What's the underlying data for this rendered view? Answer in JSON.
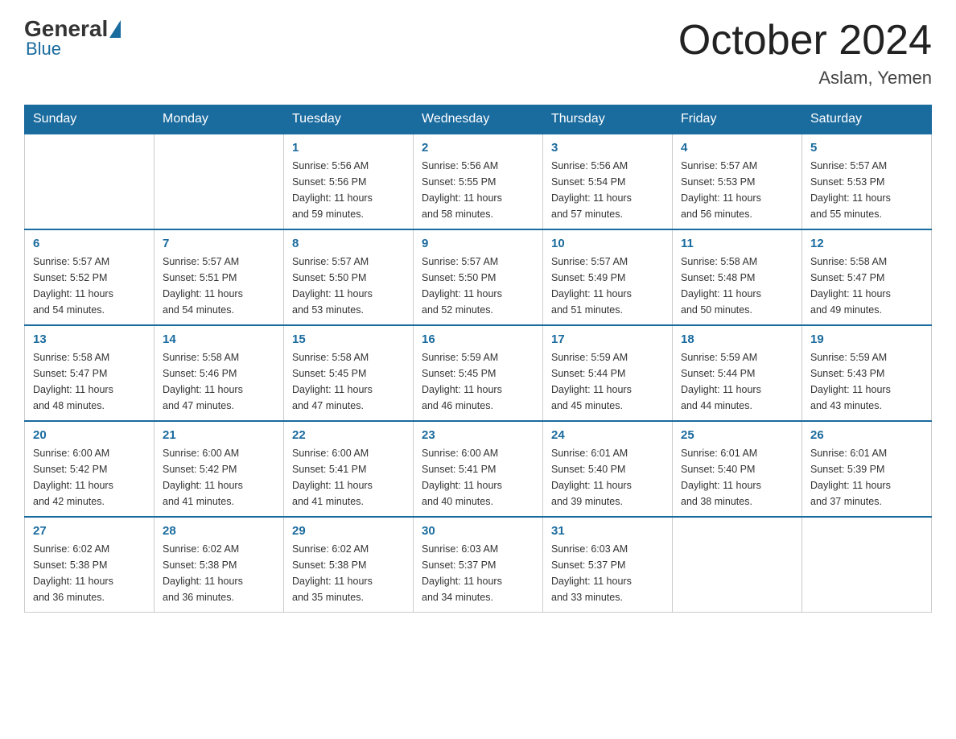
{
  "logo": {
    "general": "General",
    "blue": "Blue"
  },
  "title": "October 2024",
  "location": "Aslam, Yemen",
  "days_of_week": [
    "Sunday",
    "Monday",
    "Tuesday",
    "Wednesday",
    "Thursday",
    "Friday",
    "Saturday"
  ],
  "weeks": [
    [
      {
        "day": "",
        "info": ""
      },
      {
        "day": "",
        "info": ""
      },
      {
        "day": "1",
        "info": "Sunrise: 5:56 AM\nSunset: 5:56 PM\nDaylight: 11 hours\nand 59 minutes."
      },
      {
        "day": "2",
        "info": "Sunrise: 5:56 AM\nSunset: 5:55 PM\nDaylight: 11 hours\nand 58 minutes."
      },
      {
        "day": "3",
        "info": "Sunrise: 5:56 AM\nSunset: 5:54 PM\nDaylight: 11 hours\nand 57 minutes."
      },
      {
        "day": "4",
        "info": "Sunrise: 5:57 AM\nSunset: 5:53 PM\nDaylight: 11 hours\nand 56 minutes."
      },
      {
        "day": "5",
        "info": "Sunrise: 5:57 AM\nSunset: 5:53 PM\nDaylight: 11 hours\nand 55 minutes."
      }
    ],
    [
      {
        "day": "6",
        "info": "Sunrise: 5:57 AM\nSunset: 5:52 PM\nDaylight: 11 hours\nand 54 minutes."
      },
      {
        "day": "7",
        "info": "Sunrise: 5:57 AM\nSunset: 5:51 PM\nDaylight: 11 hours\nand 54 minutes."
      },
      {
        "day": "8",
        "info": "Sunrise: 5:57 AM\nSunset: 5:50 PM\nDaylight: 11 hours\nand 53 minutes."
      },
      {
        "day": "9",
        "info": "Sunrise: 5:57 AM\nSunset: 5:50 PM\nDaylight: 11 hours\nand 52 minutes."
      },
      {
        "day": "10",
        "info": "Sunrise: 5:57 AM\nSunset: 5:49 PM\nDaylight: 11 hours\nand 51 minutes."
      },
      {
        "day": "11",
        "info": "Sunrise: 5:58 AM\nSunset: 5:48 PM\nDaylight: 11 hours\nand 50 minutes."
      },
      {
        "day": "12",
        "info": "Sunrise: 5:58 AM\nSunset: 5:47 PM\nDaylight: 11 hours\nand 49 minutes."
      }
    ],
    [
      {
        "day": "13",
        "info": "Sunrise: 5:58 AM\nSunset: 5:47 PM\nDaylight: 11 hours\nand 48 minutes."
      },
      {
        "day": "14",
        "info": "Sunrise: 5:58 AM\nSunset: 5:46 PM\nDaylight: 11 hours\nand 47 minutes."
      },
      {
        "day": "15",
        "info": "Sunrise: 5:58 AM\nSunset: 5:45 PM\nDaylight: 11 hours\nand 47 minutes."
      },
      {
        "day": "16",
        "info": "Sunrise: 5:59 AM\nSunset: 5:45 PM\nDaylight: 11 hours\nand 46 minutes."
      },
      {
        "day": "17",
        "info": "Sunrise: 5:59 AM\nSunset: 5:44 PM\nDaylight: 11 hours\nand 45 minutes."
      },
      {
        "day": "18",
        "info": "Sunrise: 5:59 AM\nSunset: 5:44 PM\nDaylight: 11 hours\nand 44 minutes."
      },
      {
        "day": "19",
        "info": "Sunrise: 5:59 AM\nSunset: 5:43 PM\nDaylight: 11 hours\nand 43 minutes."
      }
    ],
    [
      {
        "day": "20",
        "info": "Sunrise: 6:00 AM\nSunset: 5:42 PM\nDaylight: 11 hours\nand 42 minutes."
      },
      {
        "day": "21",
        "info": "Sunrise: 6:00 AM\nSunset: 5:42 PM\nDaylight: 11 hours\nand 41 minutes."
      },
      {
        "day": "22",
        "info": "Sunrise: 6:00 AM\nSunset: 5:41 PM\nDaylight: 11 hours\nand 41 minutes."
      },
      {
        "day": "23",
        "info": "Sunrise: 6:00 AM\nSunset: 5:41 PM\nDaylight: 11 hours\nand 40 minutes."
      },
      {
        "day": "24",
        "info": "Sunrise: 6:01 AM\nSunset: 5:40 PM\nDaylight: 11 hours\nand 39 minutes."
      },
      {
        "day": "25",
        "info": "Sunrise: 6:01 AM\nSunset: 5:40 PM\nDaylight: 11 hours\nand 38 minutes."
      },
      {
        "day": "26",
        "info": "Sunrise: 6:01 AM\nSunset: 5:39 PM\nDaylight: 11 hours\nand 37 minutes."
      }
    ],
    [
      {
        "day": "27",
        "info": "Sunrise: 6:02 AM\nSunset: 5:38 PM\nDaylight: 11 hours\nand 36 minutes."
      },
      {
        "day": "28",
        "info": "Sunrise: 6:02 AM\nSunset: 5:38 PM\nDaylight: 11 hours\nand 36 minutes."
      },
      {
        "day": "29",
        "info": "Sunrise: 6:02 AM\nSunset: 5:38 PM\nDaylight: 11 hours\nand 35 minutes."
      },
      {
        "day": "30",
        "info": "Sunrise: 6:03 AM\nSunset: 5:37 PM\nDaylight: 11 hours\nand 34 minutes."
      },
      {
        "day": "31",
        "info": "Sunrise: 6:03 AM\nSunset: 5:37 PM\nDaylight: 11 hours\nand 33 minutes."
      },
      {
        "day": "",
        "info": ""
      },
      {
        "day": "",
        "info": ""
      }
    ]
  ]
}
